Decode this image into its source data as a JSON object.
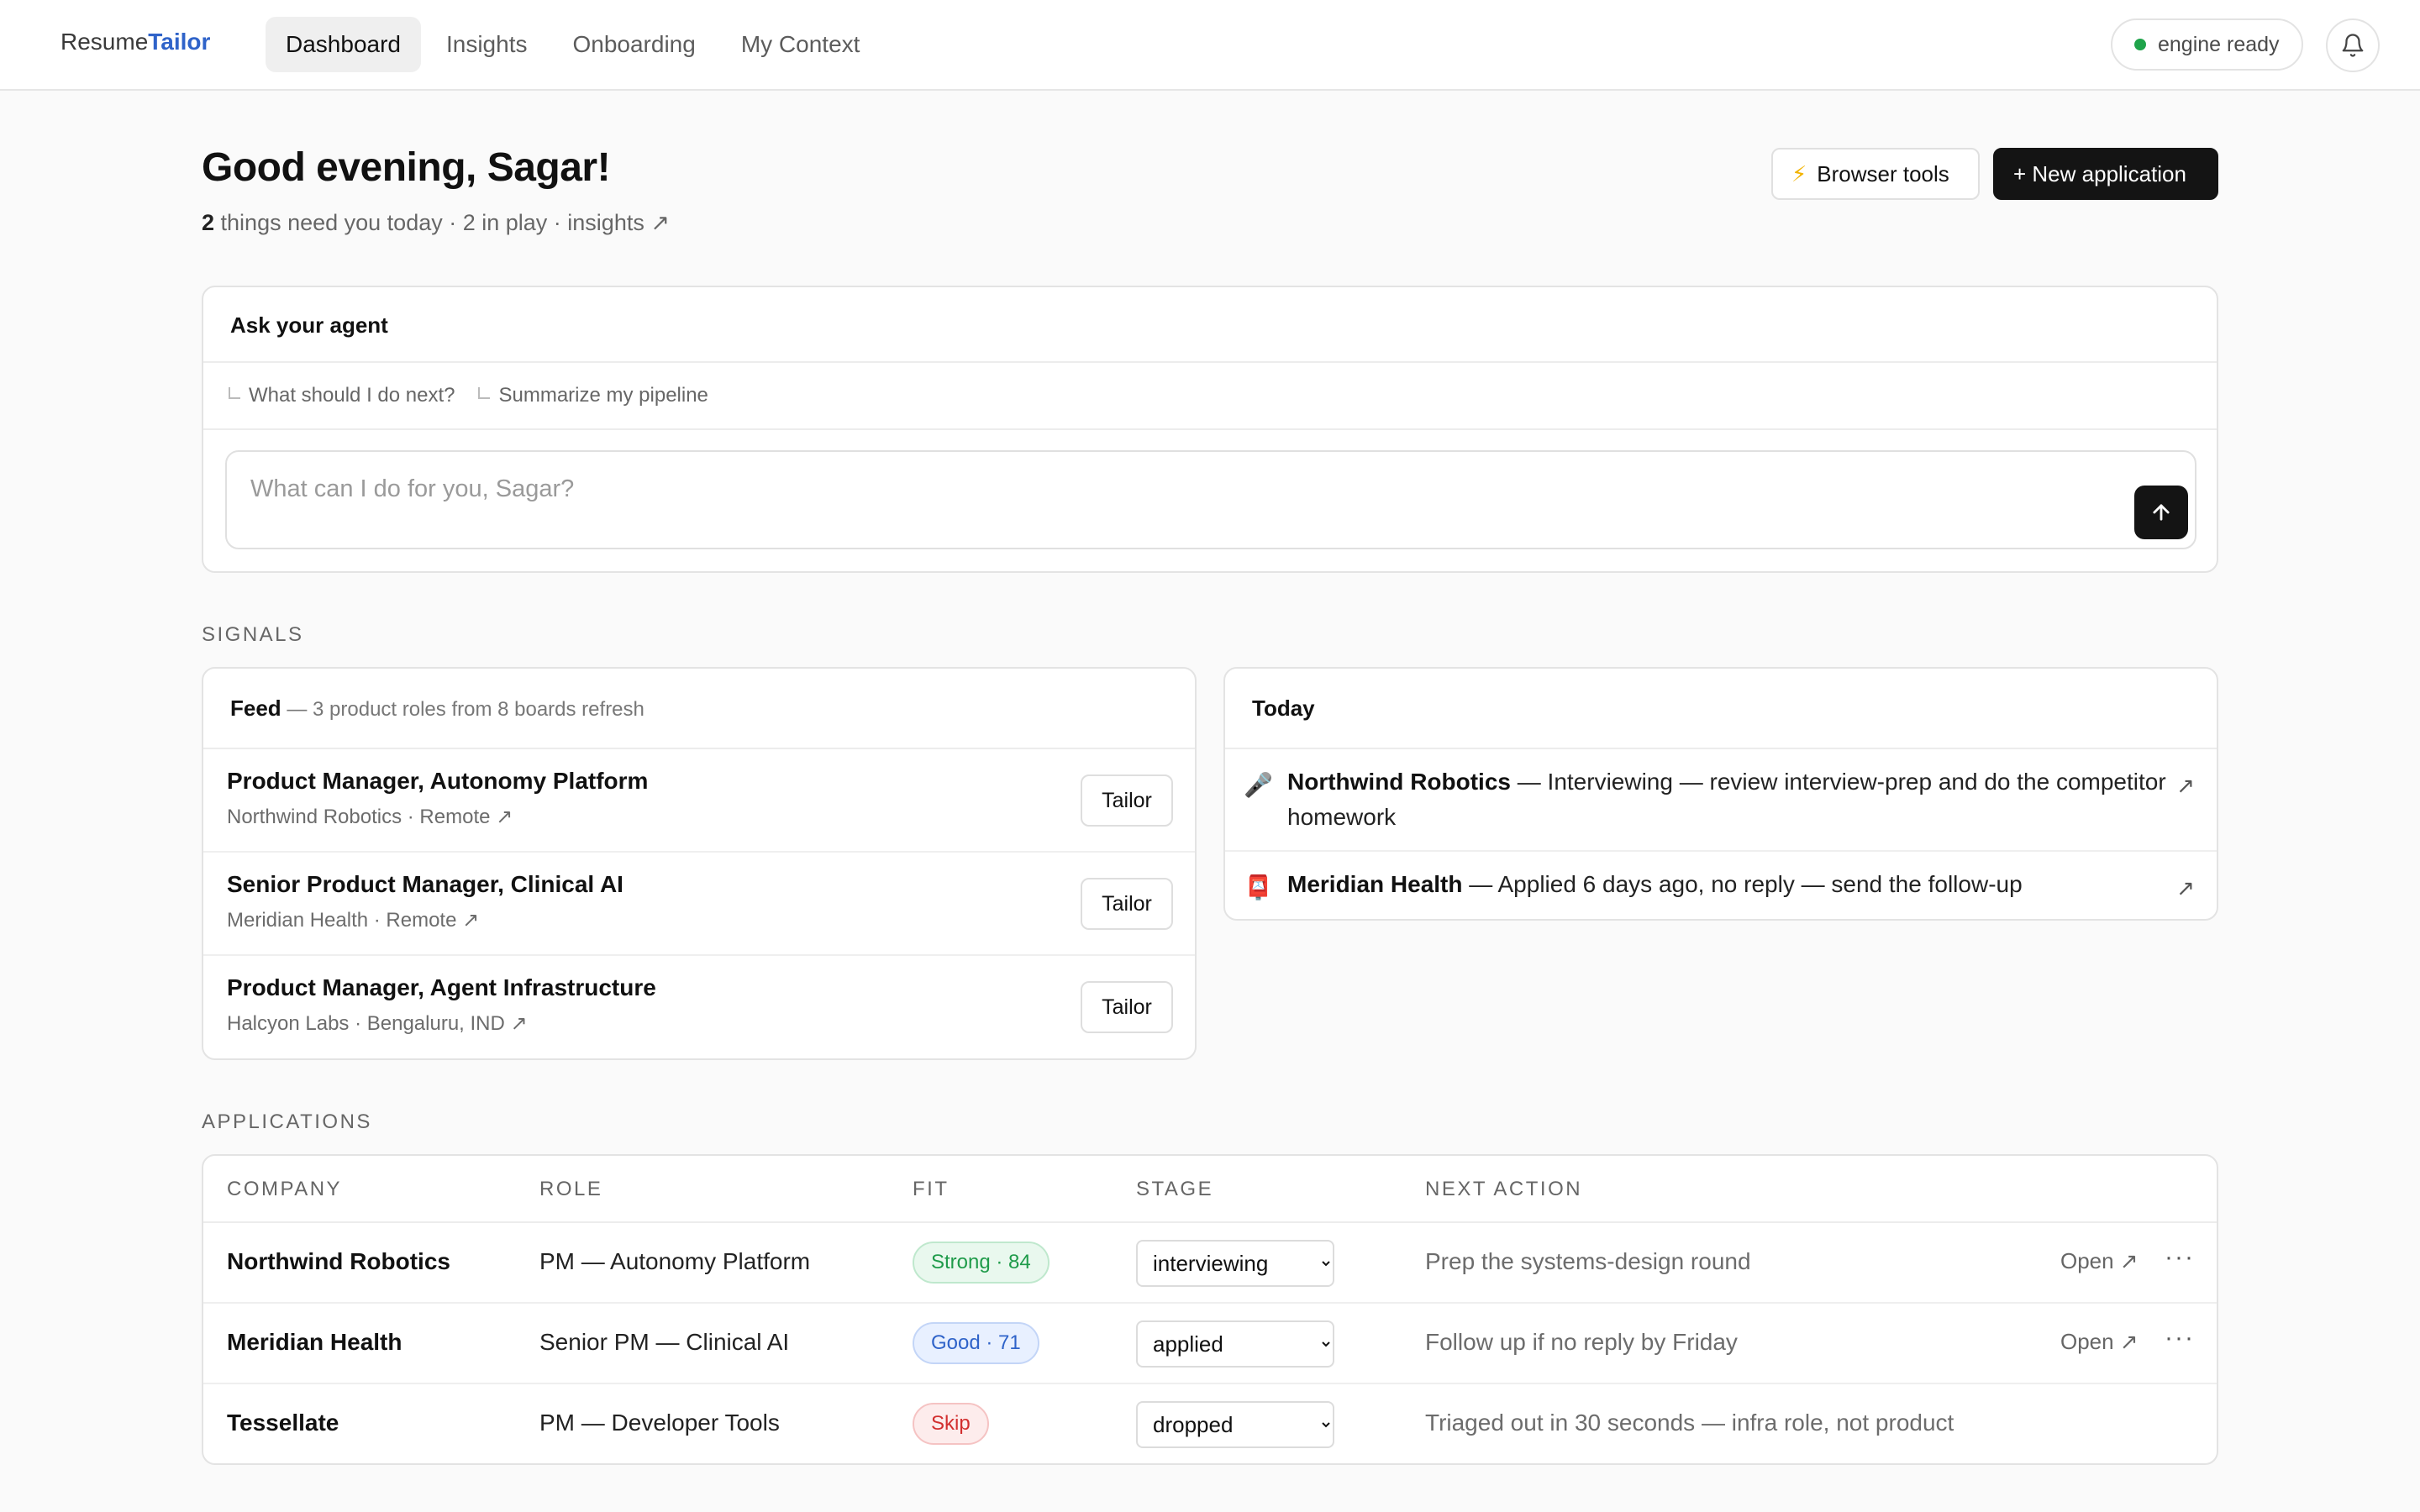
{
  "brand": {
    "part1": "Resume",
    "part2": "Tailor"
  },
  "nav": {
    "items": [
      {
        "label": "Dashboard",
        "active": true
      },
      {
        "label": "Insights",
        "active": false
      },
      {
        "label": "Onboarding",
        "active": false
      },
      {
        "label": "My Context",
        "active": false
      }
    ]
  },
  "status": {
    "engine_label": "engine ready",
    "engine_color": "#1fa34a"
  },
  "header": {
    "greeting": "Good evening, Sagar!",
    "count": "2",
    "sub_rest": " things need you today · 2 in play · insights ↗",
    "browser_tools": "Browser tools",
    "new_application": "+ New application"
  },
  "agent": {
    "title": "Ask your agent",
    "suggestions": [
      "What should I do next?",
      "Summarize my pipeline"
    ],
    "input_value": "",
    "input_placeholder": "What can I do for you, Sagar?"
  },
  "signals": {
    "section_label": "SIGNALS",
    "feed": {
      "title": "Feed",
      "subtitle": " — 3 product roles from 8 boards refresh",
      "items": [
        {
          "title": "Product Manager, Autonomy Platform",
          "meta": "Northwind Robotics · Remote ↗",
          "action": "Tailor"
        },
        {
          "title": "Senior Product Manager, Clinical AI",
          "meta": "Meridian Health · Remote ↗",
          "action": "Tailor"
        },
        {
          "title": "Product Manager, Agent Infrastructure",
          "meta": "Halcyon Labs · Bengaluru, IND ↗",
          "action": "Tailor"
        }
      ]
    },
    "today": {
      "title": "Today",
      "items": [
        {
          "icon": "microphone-icon",
          "glyph": "🎤",
          "company": "Northwind Robotics",
          "text": " — Interviewing — review interview-prep and do the competitor homework"
        },
        {
          "icon": "mailbox-icon",
          "glyph": "📮",
          "company": "Meridian Health",
          "text": " — Applied 6 days ago, no reply — send the follow-up"
        }
      ]
    }
  },
  "applications": {
    "section_label": "APPLICATIONS",
    "columns": [
      "COMPANY",
      "ROLE",
      "FIT",
      "STAGE",
      "NEXT ACTION"
    ],
    "rows": [
      {
        "company": "Northwind Robotics",
        "role": "PM — Autonomy Platform",
        "fit": "Strong · 84",
        "fit_kind": "strong",
        "stage": "interviewing",
        "next": "Prep the systems-design round",
        "open": "Open ↗",
        "more": "···"
      },
      {
        "company": "Meridian Health",
        "role": "Senior PM — Clinical AI",
        "fit": "Good · 71",
        "fit_kind": "good",
        "stage": "applied",
        "next": "Follow up if no reply by Friday",
        "open": "Open ↗",
        "more": "···"
      },
      {
        "company": "Tessellate",
        "role": "PM — Developer Tools",
        "fit": "Skip",
        "fit_kind": "skip",
        "stage": "dropped",
        "next": "Triaged out in 30 seconds — infra role, not product",
        "open": "",
        "more": ""
      }
    ],
    "stage_options": [
      "applied",
      "interviewing",
      "dropped"
    ]
  }
}
